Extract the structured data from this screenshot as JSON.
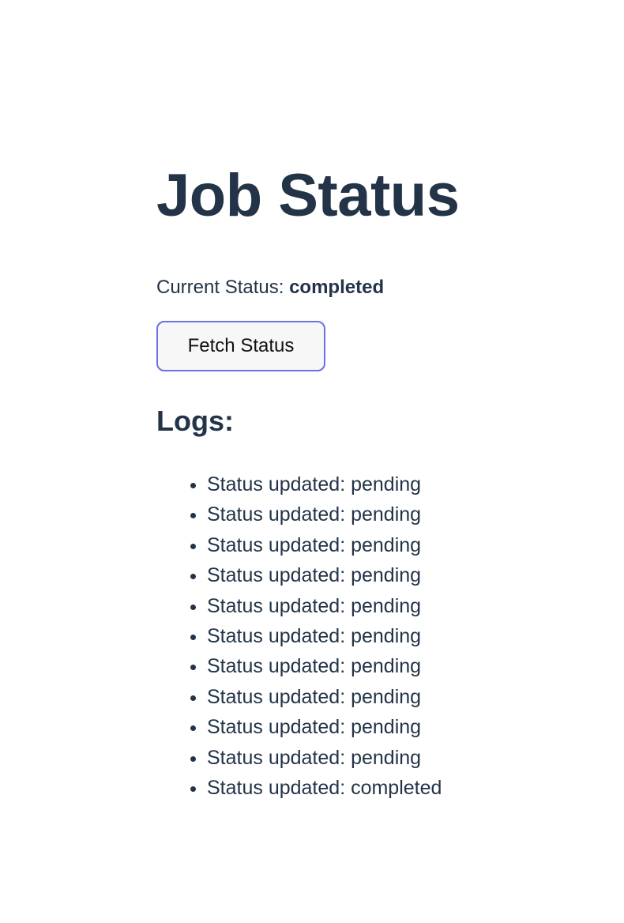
{
  "header": {
    "title": "Job Status"
  },
  "status": {
    "label": "Current Status:",
    "value": "completed"
  },
  "actions": {
    "fetch_label": "Fetch Status"
  },
  "logs": {
    "heading": "Logs:",
    "items": [
      "Status updated: pending",
      "Status updated: pending",
      "Status updated: pending",
      "Status updated: pending",
      "Status updated: pending",
      "Status updated: pending",
      "Status updated: pending",
      "Status updated: pending",
      "Status updated: pending",
      "Status updated: pending",
      "Status updated: completed"
    ]
  },
  "colors": {
    "text": "#233448",
    "button_border": "#6b70e6",
    "button_bg": "#f7f7f7"
  }
}
